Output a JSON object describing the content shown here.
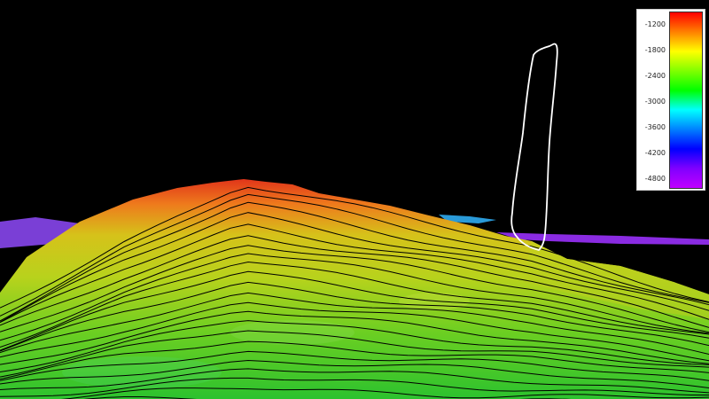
{
  "legend": {
    "ticks": [
      "-1200",
      "-1800",
      "-2400",
      "-3000",
      "-3600",
      "-4200",
      "-4800"
    ],
    "value_range": [
      -1000,
      -5000
    ],
    "colors": [
      "#ff0000",
      "#ff8000",
      "#ffff00",
      "#80ff00",
      "#00ff00",
      "#00ffff",
      "#0080ff",
      "#0000ff",
      "#8000ff",
      "#c000ff"
    ]
  },
  "scene": {
    "background": "#000000",
    "annotation_outline_color": "#ffffff",
    "contour_color": "#000000",
    "seafloor_color": "#8a2be2"
  }
}
